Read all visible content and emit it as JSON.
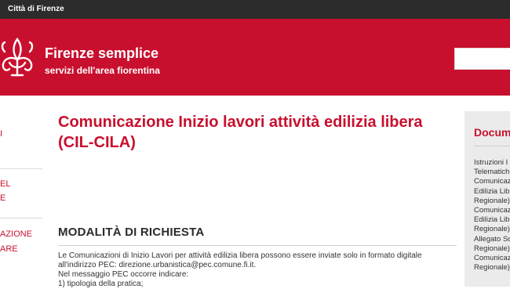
{
  "topbar": {
    "city": "Città di Firenze"
  },
  "header": {
    "site_title": "Firenze semplice",
    "site_subtitle": "servizi dell'area fiorentina",
    "brand_color": "#c8102e",
    "logo_icon": "florence-lily-icon"
  },
  "left_nav": {
    "items": [
      {
        "label": "I"
      },
      {
        "label": "EL"
      },
      {
        "label": "E"
      },
      {
        "label": "AZIONE"
      },
      {
        "label": "ARE"
      }
    ]
  },
  "main": {
    "title": "Comunicazione Inizio lavori attività edilizia libera (CIL-CILA)",
    "section_title": "MODALITÀ DI RICHIESTA",
    "paragraphs": [
      "Le Comunicazioni di Inizio Lavori per attività edilizia libera possono essere inviate solo in formato digitale",
      "all'indirizzo PEC: direzione.urbanistica@pec.comune.fi.it.",
      "Nel messaggio PEC occorre indicare:",
      "1) tipologia della pratica;"
    ]
  },
  "sidebar": {
    "heading": "Docum",
    "links": [
      "Istruzioni I",
      "Telematich",
      "Comunicaz",
      "Edilizia Lib",
      "Regionale)",
      "Comunicaz",
      "Edilizia Lib",
      "Regionale)",
      "Allegato So",
      "Regionale)",
      "Comunicaz",
      "Regionale)"
    ]
  }
}
